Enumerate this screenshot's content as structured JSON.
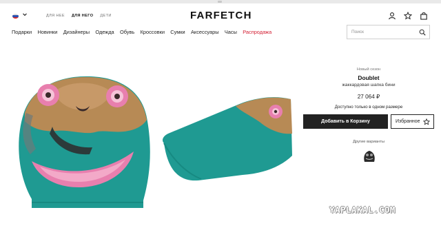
{
  "header": {
    "logo": "FARFETCH",
    "gender_tabs": [
      {
        "label": "ДЛЯ НЕЕ",
        "active": false
      },
      {
        "label": "ДЛЯ НЕГО",
        "active": true
      },
      {
        "label": "ДЕТИ",
        "active": false
      }
    ],
    "locale_flag": "russia-flag-icon",
    "icons": [
      "user-icon",
      "star-icon",
      "bag-icon"
    ]
  },
  "nav": {
    "items": [
      "Подарки",
      "Новинки",
      "Дизайнеры",
      "Одежда",
      "Обувь",
      "Кроссовки",
      "Сумки",
      "Аксессуары",
      "Часы"
    ],
    "sale_label": "Распродажа"
  },
  "search": {
    "placeholder": "Поиск"
  },
  "product": {
    "season": "Новый сезон",
    "brand": "Doublet",
    "description": "жаккардовая шапка бини",
    "price": "27 064 ₽",
    "availability": "Доступно только в одном размере",
    "add_to_bag_label": "Добавить в Корзину",
    "wishlist_label": "Избранное",
    "other_variants_label": "Другие варианты"
  },
  "watermark": "YAPLAKAL.COM",
  "colors": {
    "accent_sale": "#d31f33",
    "primary_button": "#222222",
    "beanie_teal": "#1f9a92"
  }
}
